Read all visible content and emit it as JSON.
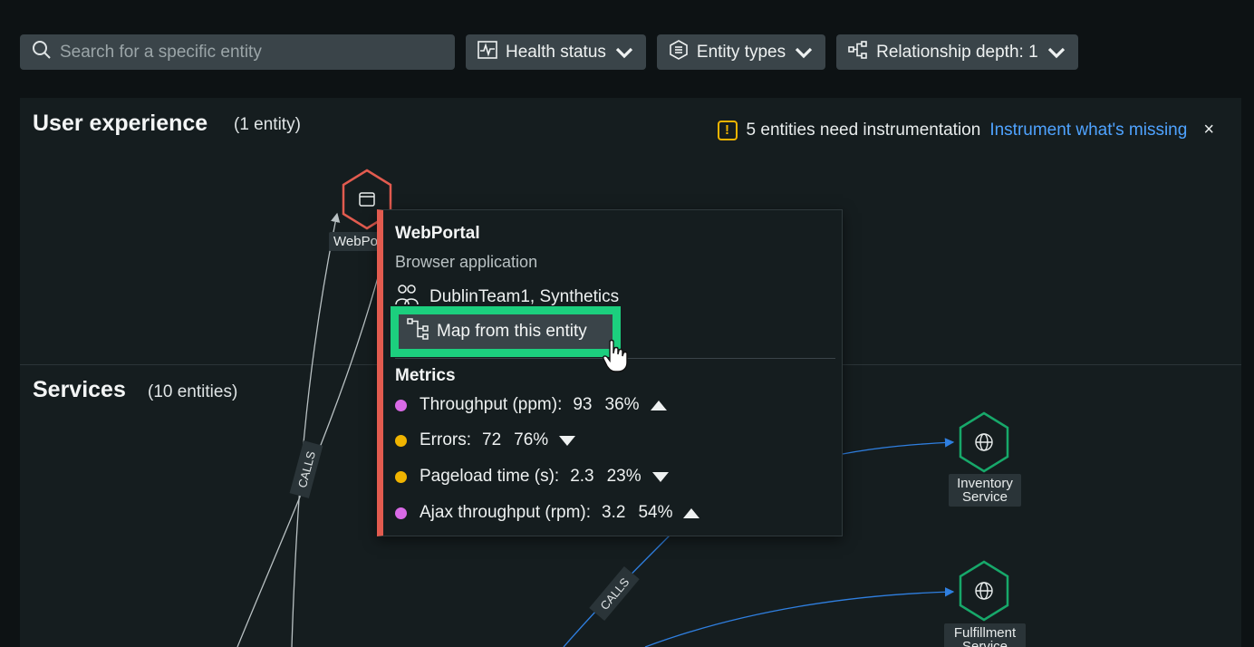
{
  "toolbar": {
    "search_placeholder": "Search for a specific entity",
    "health_label": "Health status",
    "entity_types_label": "Entity types",
    "depth_label": "Relationship depth: 1"
  },
  "user_experience": {
    "title": "User experience",
    "count": "(1 entity)"
  },
  "notice": {
    "text": "5 entities need instrumentation",
    "link": "Instrument what's missing",
    "close": "×",
    "icon": "!"
  },
  "services": {
    "title": "Services",
    "count": "(10 entities)"
  },
  "nodes": {
    "webportal_label": "WebPo",
    "inventory_label_1": "Inventory",
    "inventory_label_2": "Service",
    "fulfillment_label_1": "Fulfillment",
    "fulfillment_label_2": "Service"
  },
  "edges": {
    "calls_1": "CALLS",
    "calls_2": "CALLS"
  },
  "popover": {
    "title": "WebPortal",
    "subtitle": "Browser application",
    "team": "DublinTeam1, Synthetics",
    "map_button": "Map from this entity",
    "metrics_title": "Metrics",
    "metrics": [
      {
        "label": "Throughput (ppm):",
        "value": "93",
        "pct": "36%",
        "trend": "up",
        "color": "#d96ae6"
      },
      {
        "label": "Errors:",
        "value": "72",
        "pct": "76%",
        "trend": "down",
        "color": "#f0b400"
      },
      {
        "label": "Pageload time (s):",
        "value": "2.3",
        "pct": "23%",
        "trend": "down",
        "color": "#f0b400"
      },
      {
        "label": "Ajax throughput (rpm):",
        "value": "3.2",
        "pct": "54%",
        "trend": "up",
        "color": "#d96ae6"
      }
    ]
  },
  "colors": {
    "accent_link": "#4fa3ff",
    "alert_red": "#e25b4f",
    "healthy_green": "#1ccf7e",
    "warning": "#f0b400"
  }
}
